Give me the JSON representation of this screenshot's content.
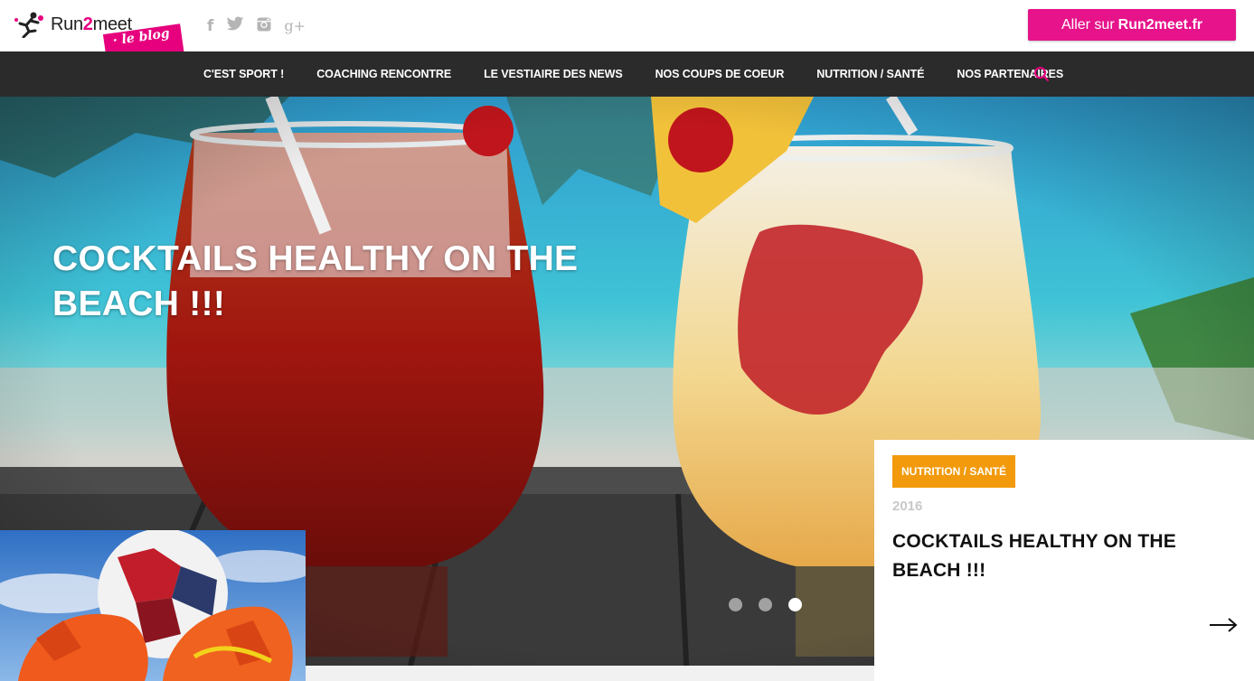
{
  "header": {
    "logo": {
      "brand_prefix": "Run",
      "brand_number": "2",
      "brand_suffix": "meet",
      "tag": "· le blog ·"
    },
    "socials": [
      {
        "icon": "facebook-icon",
        "glyph": "f"
      },
      {
        "icon": "twitter-icon",
        "glyph": "🐦"
      },
      {
        "icon": "instagram-icon",
        "glyph": "◙"
      },
      {
        "icon": "google-plus-icon",
        "glyph": "g+"
      }
    ],
    "cta": {
      "prefix": "Aller sur",
      "strong": "Run2meet.fr"
    }
  },
  "nav": {
    "items": [
      "C'EST SPORT !",
      "COACHING RENCONTRE",
      "LE VESTIAIRE DES NEWS",
      "NOS COUPS DE COEUR",
      "NUTRITION / SANTÉ",
      "NOS PARTENAIRES"
    ],
    "search_icon": "search-icon"
  },
  "hero": {
    "title": "COCKTAILS HEALTHY ON THE BEACH !!!",
    "slider": {
      "count": 3,
      "active": 3
    },
    "card": {
      "category": "NUTRITION / SANTÉ",
      "year": "2016",
      "title": "COCKTAILS HEALTHY ON THE BEACH !!!",
      "arrow_icon": "arrow-right-icon"
    }
  },
  "colors": {
    "brand_pink": "#e6138a",
    "nav_bg": "#2b2b2b",
    "category_orange": "#f29a0c",
    "search_icon": "#e6007e"
  }
}
